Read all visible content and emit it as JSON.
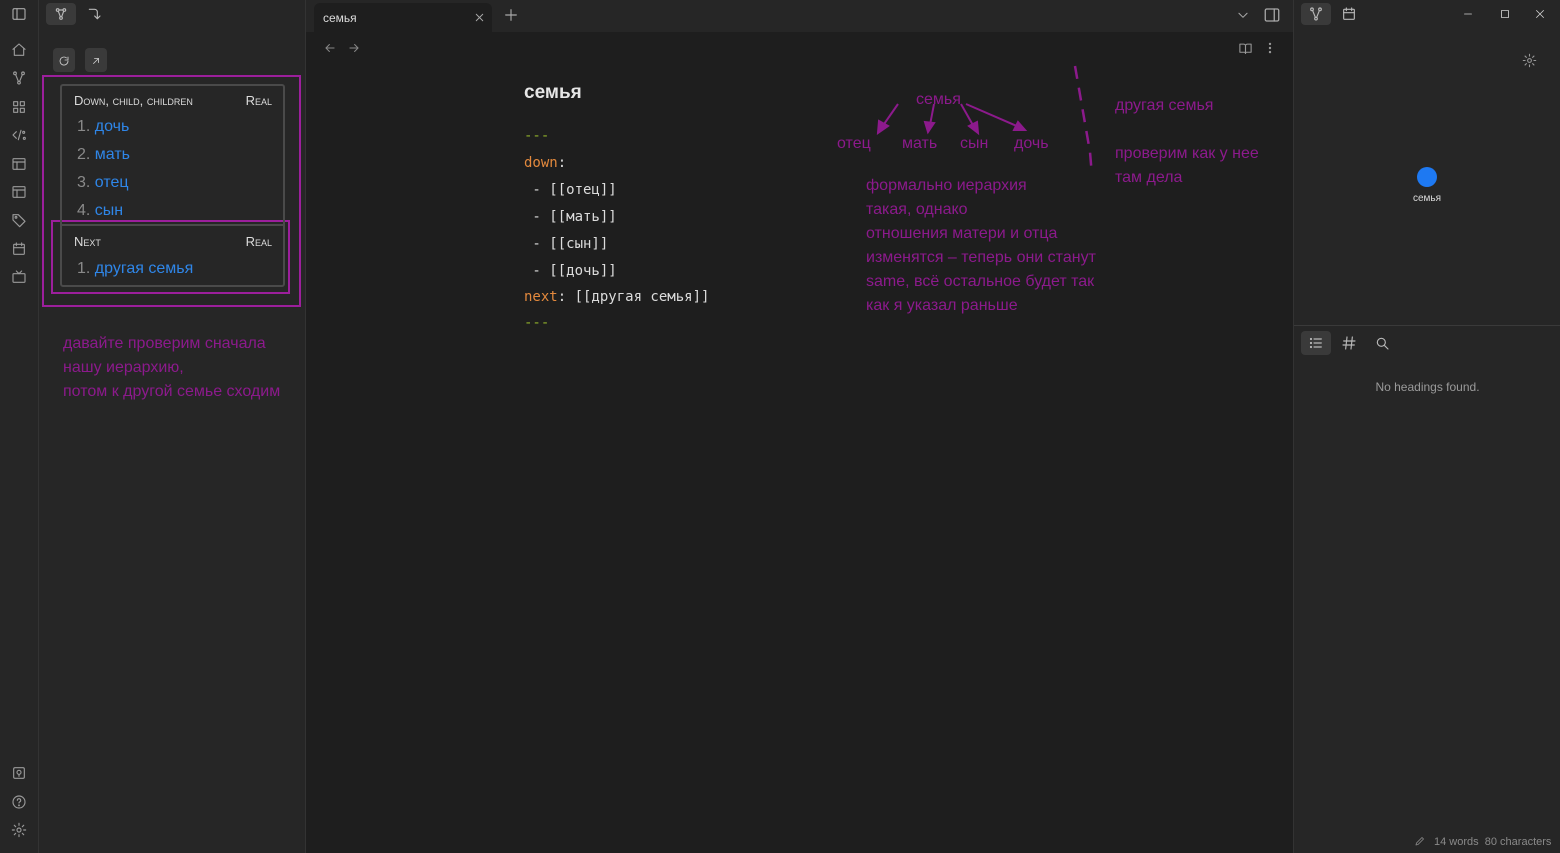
{
  "main": {
    "tab_title": "семья",
    "note_title": "семья",
    "source_lines": {
      "dash1": "---",
      "down_key": "down",
      "colon": ":",
      "item1": " - [[отец]]",
      "item2": " - [[мать]]",
      "item3": " - [[сын]]",
      "item4": " - [[дочь]]",
      "next_key": "next",
      "next_value": ": [[другая семья]]",
      "dash2": "---"
    },
    "annotations": {
      "parent": "семья",
      "child_father": "отец",
      "child_mother": "мать",
      "child_son": "сын",
      "child_daughter": "дочь",
      "explain_lines": [
        "формально иерархия",
        "такая, однако",
        "отношения матери и отца",
        "изменятся – теперь они станут",
        "same, всё остальное будет так",
        "как я указал раньше"
      ],
      "other_family": "другая семья",
      "check_lines": [
        "проверим как у нее",
        "там дела"
      ]
    }
  },
  "breadcrumbs": {
    "down_title": "Down, child, children",
    "down_real": "Real",
    "down_items": [
      {
        "num": "1.",
        "label": "дочь"
      },
      {
        "num": "2.",
        "label": "мать"
      },
      {
        "num": "3.",
        "label": "отец"
      },
      {
        "num": "4.",
        "label": "сын"
      }
    ],
    "next_title": "Next",
    "next_real": "Real",
    "next_items": [
      {
        "num": "1.",
        "label": "другая семья"
      }
    ]
  },
  "sidebar_note": {
    "lines": [
      "давайте проверим сначала",
      "нашу иерархию,",
      "потом к другой семье сходим"
    ]
  },
  "right": {
    "graph_node_label": "семья",
    "no_headings": "No headings found.",
    "status_words": "14 words",
    "status_chars": "80 characters"
  },
  "colors": {
    "accent_link": "#2f86e8",
    "annotation": "#8c1a8c",
    "frontmatter_dash": "#8fae2b",
    "frontmatter_key": "#e3893d",
    "graph_node": "#1e79f2"
  },
  "icons": [
    "sidebar-toggle-icon",
    "breadcrumbs-icon",
    "arrow-return-icon",
    "home-icon",
    "graph-icon",
    "grid-icon",
    "code-icon",
    "layout-icon",
    "template-icon",
    "tag-icon",
    "calendar-icon",
    "tv-icon",
    "vault-icon",
    "help-icon",
    "settings-icon",
    "refresh-icon",
    "open-icon",
    "close-icon",
    "plus-icon",
    "chevron-down-icon",
    "book-icon",
    "more-icon",
    "list-icon",
    "hash-icon",
    "search-icon",
    "pencil-icon",
    "minimize-icon",
    "maximize-icon",
    "window-close-icon"
  ]
}
